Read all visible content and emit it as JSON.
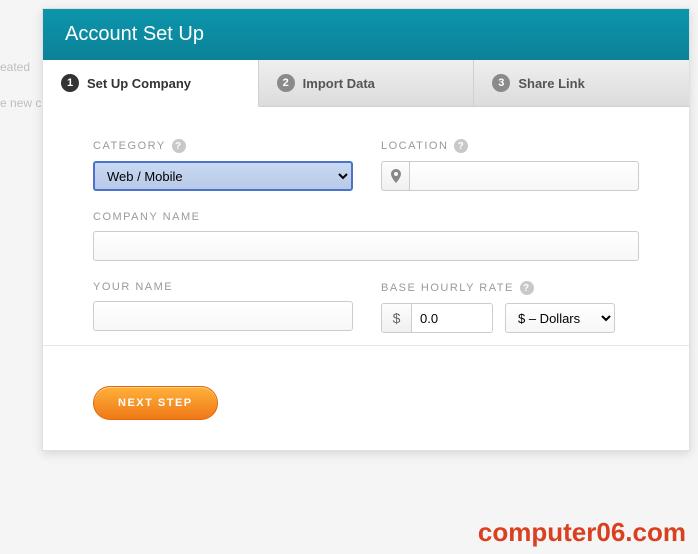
{
  "background": {
    "line1": "eated",
    "line2": "e new c"
  },
  "modal": {
    "title": "Account Set Up"
  },
  "tabs": [
    {
      "num": "1",
      "label": "Set Up Company"
    },
    {
      "num": "2",
      "label": "Import Data"
    },
    {
      "num": "3",
      "label": "Share Link"
    }
  ],
  "form": {
    "category": {
      "label": "CATEGORY",
      "value": "Web / Mobile"
    },
    "location": {
      "label": "LOCATION",
      "icon": "📍",
      "value": ""
    },
    "company": {
      "label": "COMPANY NAME",
      "value": ""
    },
    "name": {
      "label": "YOUR NAME",
      "value": ""
    },
    "rate": {
      "label": "BASE HOURLY RATE",
      "symbol": "$",
      "value": "0.0",
      "currency": "$ – Dollars"
    }
  },
  "actions": {
    "next": "NEXT STEP"
  },
  "watermark": "computer06.com"
}
